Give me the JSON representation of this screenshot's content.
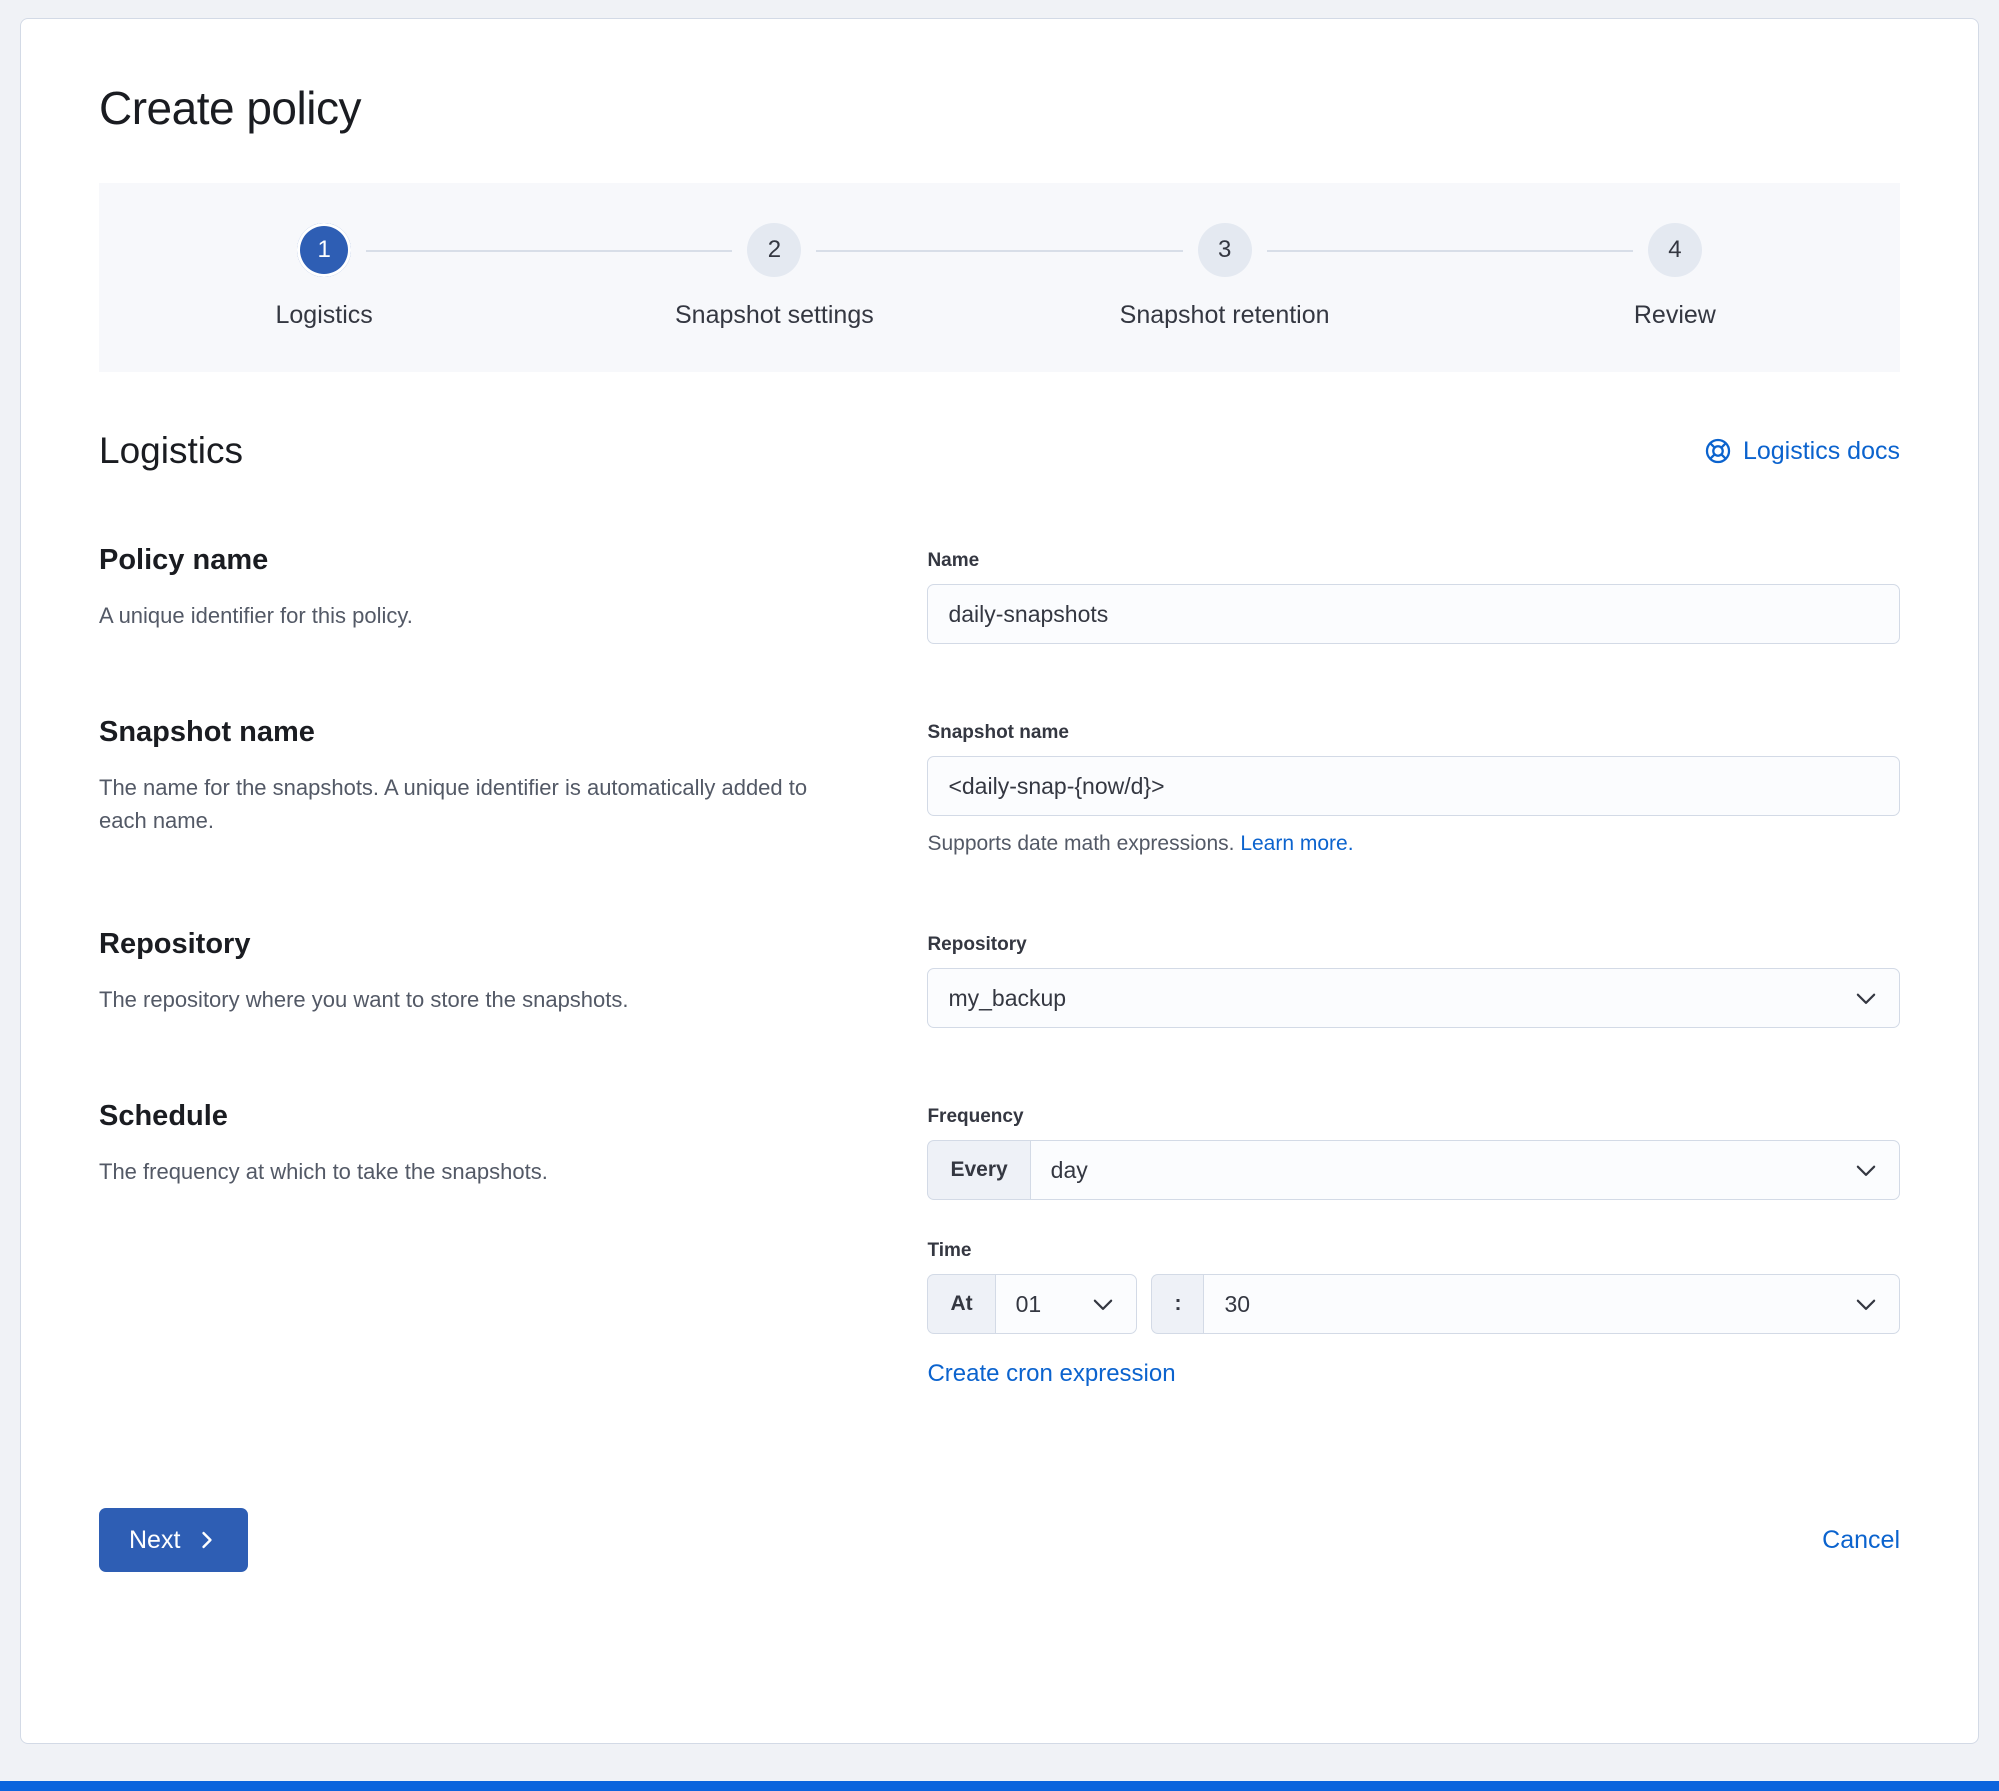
{
  "page": {
    "title": "Create policy"
  },
  "stepper": {
    "steps": [
      {
        "number": "1",
        "label": "Logistics",
        "active": true
      },
      {
        "number": "2",
        "label": "Snapshot settings",
        "active": false
      },
      {
        "number": "3",
        "label": "Snapshot retention",
        "active": false
      },
      {
        "number": "4",
        "label": "Review",
        "active": false
      }
    ]
  },
  "section": {
    "title": "Logistics",
    "docs_link": "Logistics docs"
  },
  "form": {
    "policy_name": {
      "heading": "Policy name",
      "description": "A unique identifier for this policy.",
      "label": "Name",
      "value": "daily-snapshots"
    },
    "snapshot_name": {
      "heading": "Snapshot name",
      "description": "The name for the snapshots. A unique identifier is automatically added to each name.",
      "label": "Snapshot name",
      "value": "<daily-snap-{now/d}>",
      "help": "Supports date math expressions.",
      "help_link": "Learn more."
    },
    "repository": {
      "heading": "Repository",
      "description": "The repository where you want to store the snapshots.",
      "label": "Repository",
      "value": "my_backup"
    },
    "schedule": {
      "heading": "Schedule",
      "description": "The frequency at which to take the snapshots.",
      "frequency_label": "Frequency",
      "frequency_prepend": "Every",
      "frequency_value": "day",
      "time_label": "Time",
      "time_prepend": "At",
      "hour_value": "01",
      "separator": ":",
      "minute_value": "30",
      "cron_link": "Create cron expression"
    }
  },
  "footer": {
    "next_label": "Next",
    "cancel_label": "Cancel"
  },
  "icons": {
    "docs_icon": "help-ring",
    "select_icon": "chevron-down",
    "next_icon": "chevron-right"
  },
  "colors": {
    "primary_button": "#2e5eb4",
    "link": "#0b63ce",
    "accent_bar": "#0b64dd",
    "border": "#d3dae6"
  }
}
